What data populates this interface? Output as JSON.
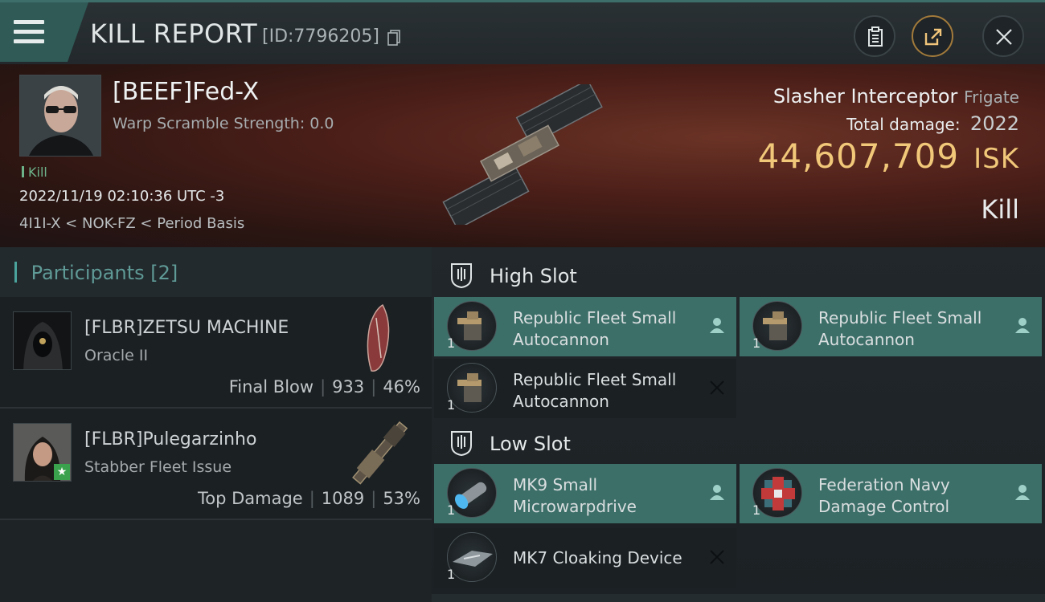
{
  "header": {
    "title": "KILL REPORT",
    "kill_id": "[ID:7796205]"
  },
  "victim": {
    "name": "[BEEF]Fed-X",
    "warp_scramble": "Warp Scramble Strength: 0.0",
    "tag": "Kill",
    "datetime": "2022/11/19 02:10:36 UTC -3",
    "location": "4I1I-X < NOK-FZ < Period Basis",
    "ship_name": "Slasher Interceptor",
    "ship_class": "Frigate",
    "total_damage_label": "Total damage:",
    "total_damage": "2022",
    "isk_value": "44,607,709",
    "isk_unit": "ISK",
    "result": "Kill"
  },
  "participants": {
    "label": "Participants",
    "count": "[2]",
    "items": [
      {
        "name": "[FLBR]ZETSU MACHINE",
        "ship": "Oracle II",
        "role": "Final Blow",
        "damage": "933",
        "percent": "46%"
      },
      {
        "name": "[FLBR]Pulegarzinho",
        "ship": "Stabber Fleet Issue",
        "role": "Top Damage",
        "damage": "1089",
        "percent": "53%"
      }
    ]
  },
  "fitting": {
    "high_slot": {
      "title": "High Slot",
      "modules": [
        {
          "name": "Republic Fleet Small Autocannon",
          "qty": "1",
          "status": "pilot"
        },
        {
          "name": "Republic Fleet Small Autocannon",
          "qty": "1",
          "status": "pilot"
        },
        {
          "name": "Republic Fleet Small Autocannon",
          "qty": "1",
          "status": "destroyed"
        }
      ]
    },
    "low_slot": {
      "title": "Low Slot",
      "modules": [
        {
          "name": "MK9 Small Microwarpdrive",
          "qty": "1",
          "status": "pilot"
        },
        {
          "name": "Federation Navy Damage Control",
          "qty": "1",
          "status": "pilot"
        },
        {
          "name": "MK7 Cloaking Device",
          "qty": "1",
          "status": "destroyed"
        }
      ]
    }
  },
  "colors": {
    "accent_teal": "#3d6f69",
    "isk_gold": "#f1c779",
    "kill_green": "#6db38a"
  }
}
